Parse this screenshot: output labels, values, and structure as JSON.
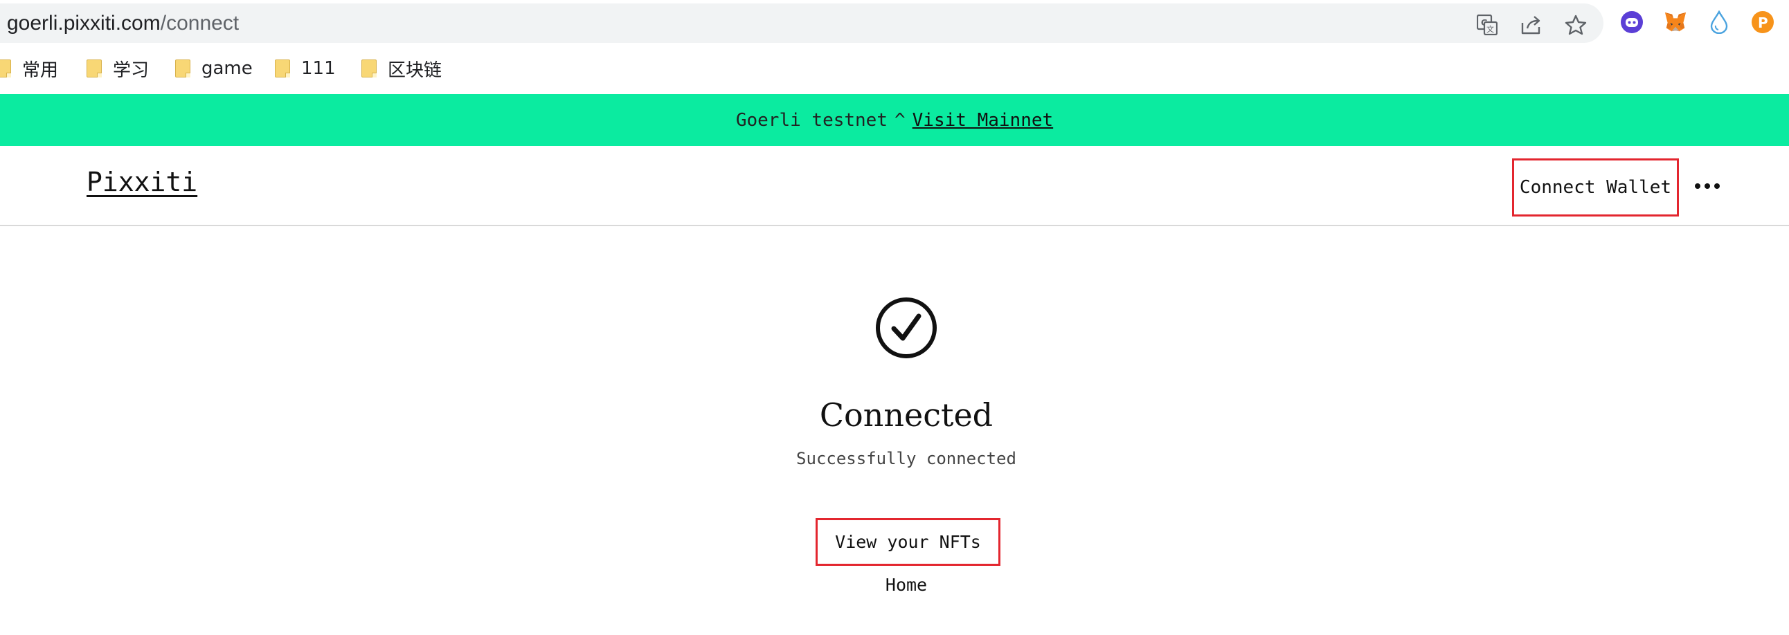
{
  "browser": {
    "url_host": "goerli.pixxiti.com",
    "url_path": "/connect",
    "omnibox_icons": [
      "translate-icon",
      "share-icon",
      "bookmark-star-icon"
    ],
    "extension_icons": [
      "chatbot-extension-icon",
      "metamask-fox-icon",
      "water-drop-extension-icon",
      "orange-p-extension-icon"
    ],
    "bookmarks": [
      {
        "label": "常用"
      },
      {
        "label": "学习"
      },
      {
        "label": "game"
      },
      {
        "label": "111"
      },
      {
        "label": "区块链"
      }
    ]
  },
  "banner": {
    "network_text": "Goerli testnet",
    "separator": "^",
    "link_text": "Visit Mainnet",
    "background_color": "#0beba0"
  },
  "header": {
    "logo_text": "Pixxiti",
    "connect_wallet_label": "Connect Wallet",
    "more_icon": "more-horizontal-icon",
    "highlight_color": "#e3262f"
  },
  "main": {
    "status_icon": "check-circle-icon",
    "title": "Connected",
    "subtitle": "Successfully connected",
    "view_nfts_label": "View your NFTs",
    "home_label": "Home"
  }
}
